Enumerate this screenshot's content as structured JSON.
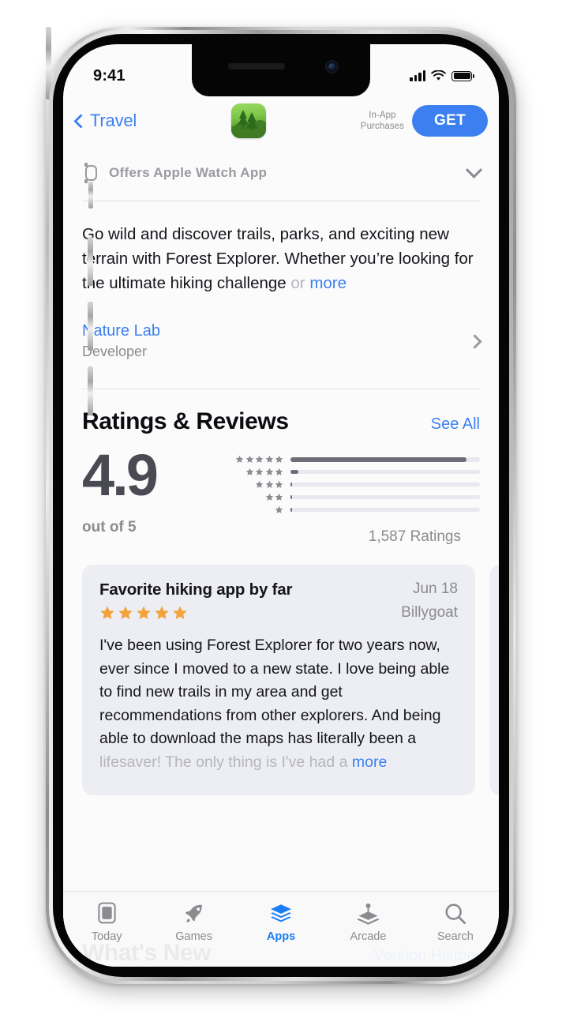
{
  "status_bar": {
    "time": "9:41",
    "signal_icon": "cellular-bars-icon",
    "wifi_icon": "wifi-icon",
    "battery_icon": "battery-full-icon"
  },
  "nav": {
    "back_label": "Travel",
    "back_icon": "chevron-left-icon",
    "app_icon": "forest-app-icon",
    "in_app_line1": "In-App",
    "in_app_line2": "Purchases",
    "get_label": "GET"
  },
  "watch_row": {
    "icon": "apple-watch-icon",
    "label": "Offers Apple Watch App",
    "expand_icon": "chevron-down-icon"
  },
  "description": {
    "text": "Go wild and discover trails, parks, and exciting new terrain with Forest Explorer. Whether you’re looking for the ultimate hiking challenge ",
    "faded_tail": "or",
    "more_label": "more"
  },
  "developer": {
    "name": "Nature Lab",
    "role": "Developer",
    "chevron_icon": "chevron-right-icon"
  },
  "ratings_section": {
    "title": "Ratings & Reviews",
    "see_all_label": "See All",
    "score": "4.9",
    "out_of_label": "out of 5",
    "ratings_count_label": "1,587 Ratings"
  },
  "chart_data": {
    "type": "bar",
    "title": "Ratings & Reviews",
    "categories": [
      "5 stars",
      "4 stars",
      "3 stars",
      "2 stars",
      "1 star"
    ],
    "values": [
      93,
      4,
      1,
      1,
      1
    ],
    "xlabel": "",
    "ylabel": "",
    "ylim": [
      0,
      100
    ],
    "average": 4.9,
    "total_ratings": 1587,
    "total_ratings_label": "1,587 Ratings",
    "grid": false,
    "legend": "none"
  },
  "review": {
    "title": "Favorite hiking app by far",
    "date": "Jun 18",
    "author": "Billygoat",
    "stars": 5,
    "body": "I've been using Forest Explorer for two years now, ever since I moved to a new state. I love being able to find new trails in my area and get recommendations from other explorers. And being able to download the maps has literally been a ",
    "faded_tail": "lifesaver! The only thing is I've had a",
    "more_label": "more"
  },
  "whats_new": {
    "title": "What's New",
    "link_label": "Version History"
  },
  "tabbar": {
    "items": [
      {
        "label": "Today",
        "icon": "today-card-icon",
        "active": false
      },
      {
        "label": "Games",
        "icon": "rocket-icon",
        "active": false
      },
      {
        "label": "Apps",
        "icon": "app-stack-icon",
        "active": true
      },
      {
        "label": "Arcade",
        "icon": "joystick-icon",
        "active": false
      },
      {
        "label": "Search",
        "icon": "magnifier-icon",
        "active": false
      }
    ]
  },
  "colors": {
    "accent": "#3b7ff0",
    "tab_active": "#1b7ef5",
    "star": "#f2a33c",
    "card_bg": "#eceef4",
    "bar_fill": "#6e6e78"
  }
}
